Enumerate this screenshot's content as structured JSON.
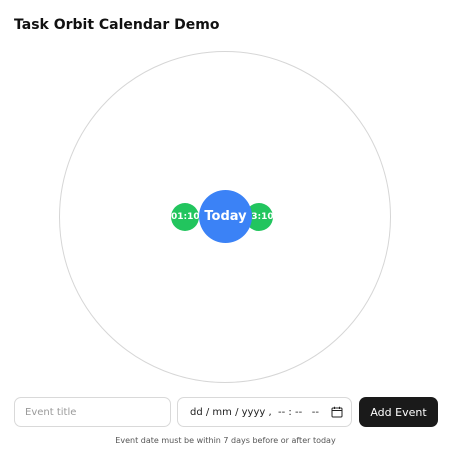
{
  "page": {
    "title": "Task Orbit Calendar Demo"
  },
  "orbit": {
    "center_label": "Today",
    "events": [
      {
        "time": "01:10"
      },
      {
        "time": "23:10"
      }
    ]
  },
  "form": {
    "title_input": {
      "placeholder": "Event title",
      "value": ""
    },
    "datetime_input": {
      "display": "dd / mm / yyyy ,  -- : --   --"
    },
    "add_button_label": "Add Event"
  },
  "hint": {
    "text": "Event date must be within 7 days before or after today"
  },
  "colors": {
    "today": "#3b82f6",
    "event": "#22c55e",
    "button": "#1a1a1a",
    "orbit_ring": "#d6d6d6"
  },
  "icons": {
    "calendar": "calendar-icon"
  }
}
